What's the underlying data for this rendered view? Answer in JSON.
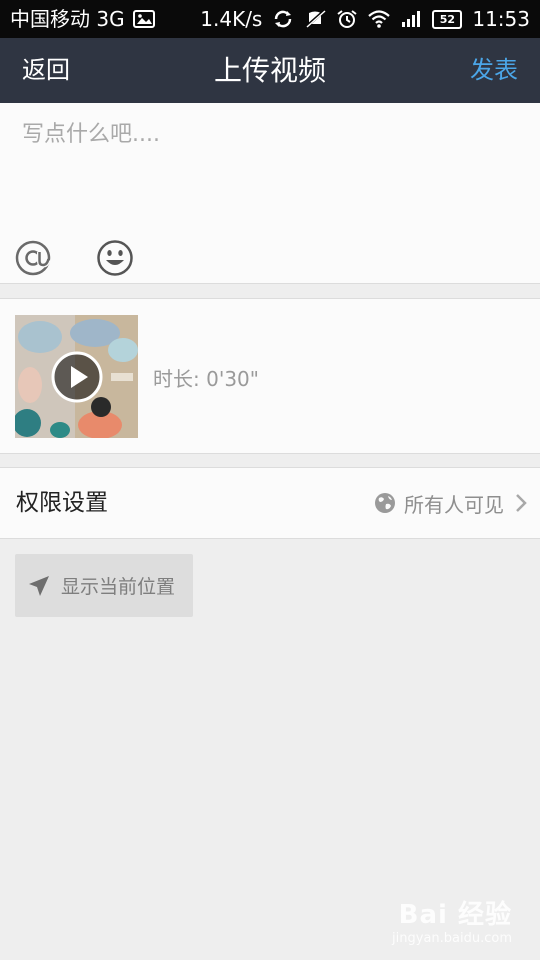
{
  "status_bar": {
    "carrier": "中国移动 3G",
    "speed": "1.4K/s",
    "battery": "52",
    "time": "11:53",
    "icons": [
      "image-icon",
      "sync-icon",
      "vibrate-off-icon",
      "alarm-icon",
      "wifi-icon",
      "signal-icon",
      "battery-icon"
    ]
  },
  "header": {
    "back_label": "返回",
    "title": "上传视频",
    "publish_label": "发表",
    "publish_color": "#4ba6e8",
    "background": "#2f3542"
  },
  "composer": {
    "placeholder": "写点什么吧....",
    "icons": [
      "at-icon",
      "emoji-icon"
    ]
  },
  "video": {
    "duration_text": "时长: 0'30\"",
    "thumbnail_icon": "play-icon"
  },
  "permission": {
    "label": "权限设置",
    "value": "所有人可见",
    "icons": [
      "globe-icon",
      "chevron-right-icon"
    ]
  },
  "location": {
    "label": "显示当前位置",
    "icon": "location-arrow-icon"
  },
  "watermark": {
    "brand": "Bai 经验",
    "url": "jingyan.baidu.com"
  }
}
